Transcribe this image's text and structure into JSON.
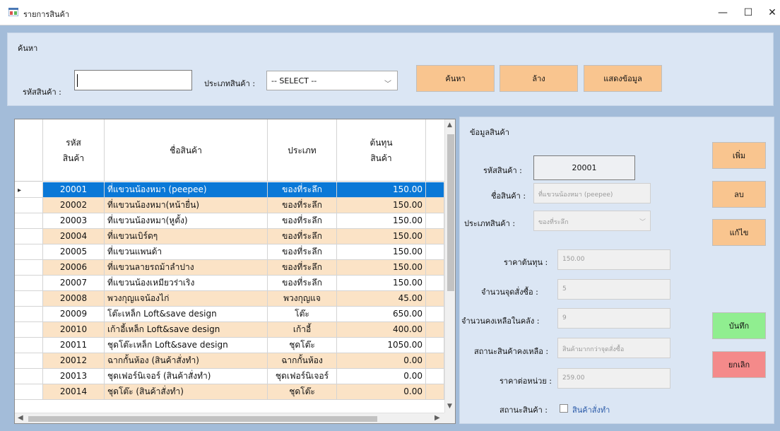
{
  "window": {
    "title": "รายการสินค้า",
    "min_glyph": "—",
    "max_glyph": "☐",
    "close_glyph": "✕"
  },
  "search": {
    "group_label": "ค้นหา",
    "code_label": "รหัสสินค้า :",
    "code_value": "",
    "type_label": "ประเภทสินค้า :",
    "type_selected": "-- SELECT --",
    "search_button": "ค้นหา",
    "clear_button": "ล้าง",
    "show_button": "แสดงข้อมูล"
  },
  "grid": {
    "columns": [
      "รหัส\nสินค้า",
      "ชื่อสินค้า",
      "ประเภท",
      "ต้นทุน\nสินค้า"
    ],
    "rows": [
      {
        "code": "20001",
        "name": "ที่แขวนน้องหมา (peepee)",
        "type": "ของที่ระลึก",
        "cost": "150.00"
      },
      {
        "code": "20002",
        "name": "ที่แขวนน้องหมา(หน้ายื่น)",
        "type": "ของที่ระลึก",
        "cost": "150.00"
      },
      {
        "code": "20003",
        "name": "ที่แขวนน้องหมา(หูตั้ง)",
        "type": "ของที่ระลึก",
        "cost": "150.00"
      },
      {
        "code": "20004",
        "name": "ที่แขวนเบิร์ดๆ",
        "type": "ของที่ระลึก",
        "cost": "150.00"
      },
      {
        "code": "20005",
        "name": "ที่แขวนแพนด้า",
        "type": "ของที่ระลึก",
        "cost": "150.00"
      },
      {
        "code": "20006",
        "name": "ที่แขวนลายรถม้าลำปาง",
        "type": "ของที่ระลึก",
        "cost": "150.00"
      },
      {
        "code": "20007",
        "name": "ที่แขวนน้องเหมียวร่าเริง",
        "type": "ของที่ระลึก",
        "cost": "150.00"
      },
      {
        "code": "20008",
        "name": "พวงกุญแจน้องไก่",
        "type": "พวงกุญแจ",
        "cost": "45.00"
      },
      {
        "code": "20009",
        "name": "โต๊ะเหล็ก Loft&save design",
        "type": "โต๊ะ",
        "cost": "650.00"
      },
      {
        "code": "20010",
        "name": "เก้าอี้เหล็ก Loft&save design",
        "type": "เก้าอี้",
        "cost": "400.00"
      },
      {
        "code": "20011",
        "name": "ชุดโต๊ะเหล็ก Loft&save design",
        "type": "ชุดโต๊ะ",
        "cost": "1050.00"
      },
      {
        "code": "20012",
        "name": "ฉากกั้นห้อง (สินค้าสั่งทำ)",
        "type": "ฉากกั้นห้อง",
        "cost": "0.00"
      },
      {
        "code": "20013",
        "name": "ชุดเฟอร์นิเจอร์ (สินค้าสั่งทำ)",
        "type": "ชุดเฟอร์นิเจอร์",
        "cost": "0.00"
      },
      {
        "code": "20014",
        "name": "ชุดโต๊ะ (สินค้าสั่งทำ)",
        "type": "ชุดโต๊ะ",
        "cost": "0.00"
      }
    ]
  },
  "detail": {
    "group_label": "ข้อมูลสินค้า",
    "code_label": "รหัสสินค้า :",
    "code_value": "20001",
    "name_label": "ชื่อสินค้า :",
    "name_value": "ที่แขวนน้องหมา (peepee)",
    "type_label": "ประเภทสินค้า :",
    "type_value": "ของที่ระลึก",
    "cost_label": "ราคาต้นทุน :",
    "cost_value": "150.00",
    "reorder_label": "จำนวนจุดสั่งซื้อ :",
    "reorder_value": "5",
    "stock_label": "จำนวนคงเหลือในคลัง :",
    "stock_value": "9",
    "stock_status_label": "สถานะสินค้าคงเหลือ :",
    "stock_status_value": "สินค้ามากกว่าจุดสั่งซื้อ",
    "unit_price_label": "ราคาต่อหน่วย :",
    "unit_price_value": "259.00",
    "product_status_label": "สถานะสินค้า :",
    "made_to_order_label": "สินค้าสั่งทำ",
    "add_button": "เพิ่ม",
    "delete_button": "ลบ",
    "edit_button": "แก้ไข",
    "save_button": "บันทึก",
    "cancel_button": "ยกเลิก"
  }
}
